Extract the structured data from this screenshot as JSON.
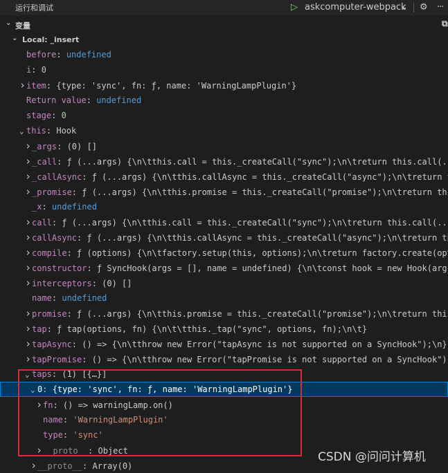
{
  "header": {
    "title": "运行和调试",
    "config_name": "askcomputer-webpack",
    "play_icon": "play-icon",
    "chevron_icon": "chevron-down-icon",
    "gear_icon": "gear-icon",
    "more_icon": "more-icon"
  },
  "variables_section": {
    "label": "变量",
    "scope_label": "Local: _insert"
  },
  "rows": [
    {
      "indent": 1,
      "twisty": "",
      "key": "before",
      "value": "undefined",
      "vclass": "kw"
    },
    {
      "indent": 1,
      "twisty": "",
      "key": "i",
      "value": "0",
      "vclass": "num"
    },
    {
      "indent": 1,
      "twisty": ">",
      "key": "item",
      "value": "{type: 'sync', fn: ƒ, name: 'WarningLampPlugin'}",
      "vclass": "v"
    },
    {
      "indent": 1,
      "twisty": "",
      "key": "Return value",
      "value": "undefined",
      "vclass": "kw"
    },
    {
      "indent": 1,
      "twisty": "",
      "key": "stage",
      "value": "0",
      "vclass": "num"
    },
    {
      "indent": 1,
      "twisty": "v",
      "key": "this",
      "value": "Hook",
      "vclass": "v"
    },
    {
      "indent": 2,
      "twisty": ">",
      "key": "_args",
      "value": "(0) []",
      "vclass": "v"
    },
    {
      "indent": 2,
      "twisty": ">",
      "key": "_call",
      "value": "ƒ (...args) {\\n\\tthis.call = this._createCall(\"sync\");\\n\\treturn this.call(...",
      "vclass": "v"
    },
    {
      "indent": 2,
      "twisty": ">",
      "key": "_callAsync",
      "value": "ƒ (...args) {\\n\\tthis.callAsync = this._createCall(\"async\");\\n\\treturn t",
      "vclass": "v"
    },
    {
      "indent": 2,
      "twisty": ">",
      "key": "_promise",
      "value": "ƒ (...args) {\\n\\tthis.promise = this._createCall(\"promise\");\\n\\treturn thi",
      "vclass": "v"
    },
    {
      "indent": 2,
      "twisty": "",
      "key": "_x",
      "value": "undefined",
      "vclass": "kw"
    },
    {
      "indent": 2,
      "twisty": ">",
      "key": "call",
      "value": "ƒ (...args) {\\n\\tthis.call = this._createCall(\"sync\");\\n\\treturn this.call(...",
      "vclass": "v"
    },
    {
      "indent": 2,
      "twisty": ">",
      "key": "callAsync",
      "value": "ƒ (...args) {\\n\\tthis.callAsync = this._createCall(\"async\");\\n\\treturn th",
      "vclass": "v"
    },
    {
      "indent": 2,
      "twisty": ">",
      "key": "compile",
      "value": "ƒ (options) {\\n\\tfactory.setup(this, options);\\n\\treturn factory.create(opt",
      "vclass": "v"
    },
    {
      "indent": 2,
      "twisty": ">",
      "key": "constructor",
      "value": "ƒ SyncHook(args = [], name = undefined) {\\n\\tconst hook = new Hook(args",
      "vclass": "v"
    },
    {
      "indent": 2,
      "twisty": ">",
      "key": "interceptors",
      "value": "(0) []",
      "vclass": "v"
    },
    {
      "indent": 2,
      "twisty": "",
      "key": "name",
      "value": "undefined",
      "vclass": "kw"
    },
    {
      "indent": 2,
      "twisty": ">",
      "key": "promise",
      "value": "ƒ (...args) {\\n\\tthis.promise = this._createCall(\"promise\");\\n\\treturn this",
      "vclass": "v"
    },
    {
      "indent": 2,
      "twisty": ">",
      "key": "tap",
      "value": "ƒ tap(options, fn) {\\n\\t\\tthis._tap(\"sync\", options, fn);\\n\\t}",
      "vclass": "v"
    },
    {
      "indent": 2,
      "twisty": ">",
      "key": "tapAsync",
      "value": "() => {\\n\\tthrow new Error(\"tapAsync is not supported on a SyncHook\");\\n}",
      "vclass": "v"
    },
    {
      "indent": 2,
      "twisty": ">",
      "key": "tapPromise",
      "value": "() => {\\n\\tthrow new Error(\"tapPromise is not supported on a SyncHook\");",
      "vclass": "v"
    },
    {
      "indent": 2,
      "twisty": "v",
      "key": "taps",
      "value": "(1) [{…}]",
      "vclass": "v"
    },
    {
      "indent": 3,
      "twisty": "v",
      "key": "0",
      "value": "{type: 'sync', fn: ƒ, name: 'WarningLampPlugin'}",
      "vclass": "v",
      "selected": true
    },
    {
      "indent": 4,
      "twisty": ">",
      "key": "fn",
      "value": "() => warningLamp.on()",
      "vclass": "v"
    },
    {
      "indent": 4,
      "twisty": "",
      "key": "name",
      "value": "'WarningLampPlugin'",
      "vclass": "str"
    },
    {
      "indent": 4,
      "twisty": "",
      "key": "type",
      "value": "'sync'",
      "vclass": "str"
    },
    {
      "indent": 4,
      "twisty": ">",
      "key": "__proto__",
      "value": "Object",
      "vclass": "v",
      "dimkey": true
    },
    {
      "indent": 3,
      "twisty": ">",
      "key": "__proto__",
      "value": "Array(0)",
      "vclass": "v",
      "dimkey": true
    }
  ],
  "watermark": "CSDN @问问计算机"
}
